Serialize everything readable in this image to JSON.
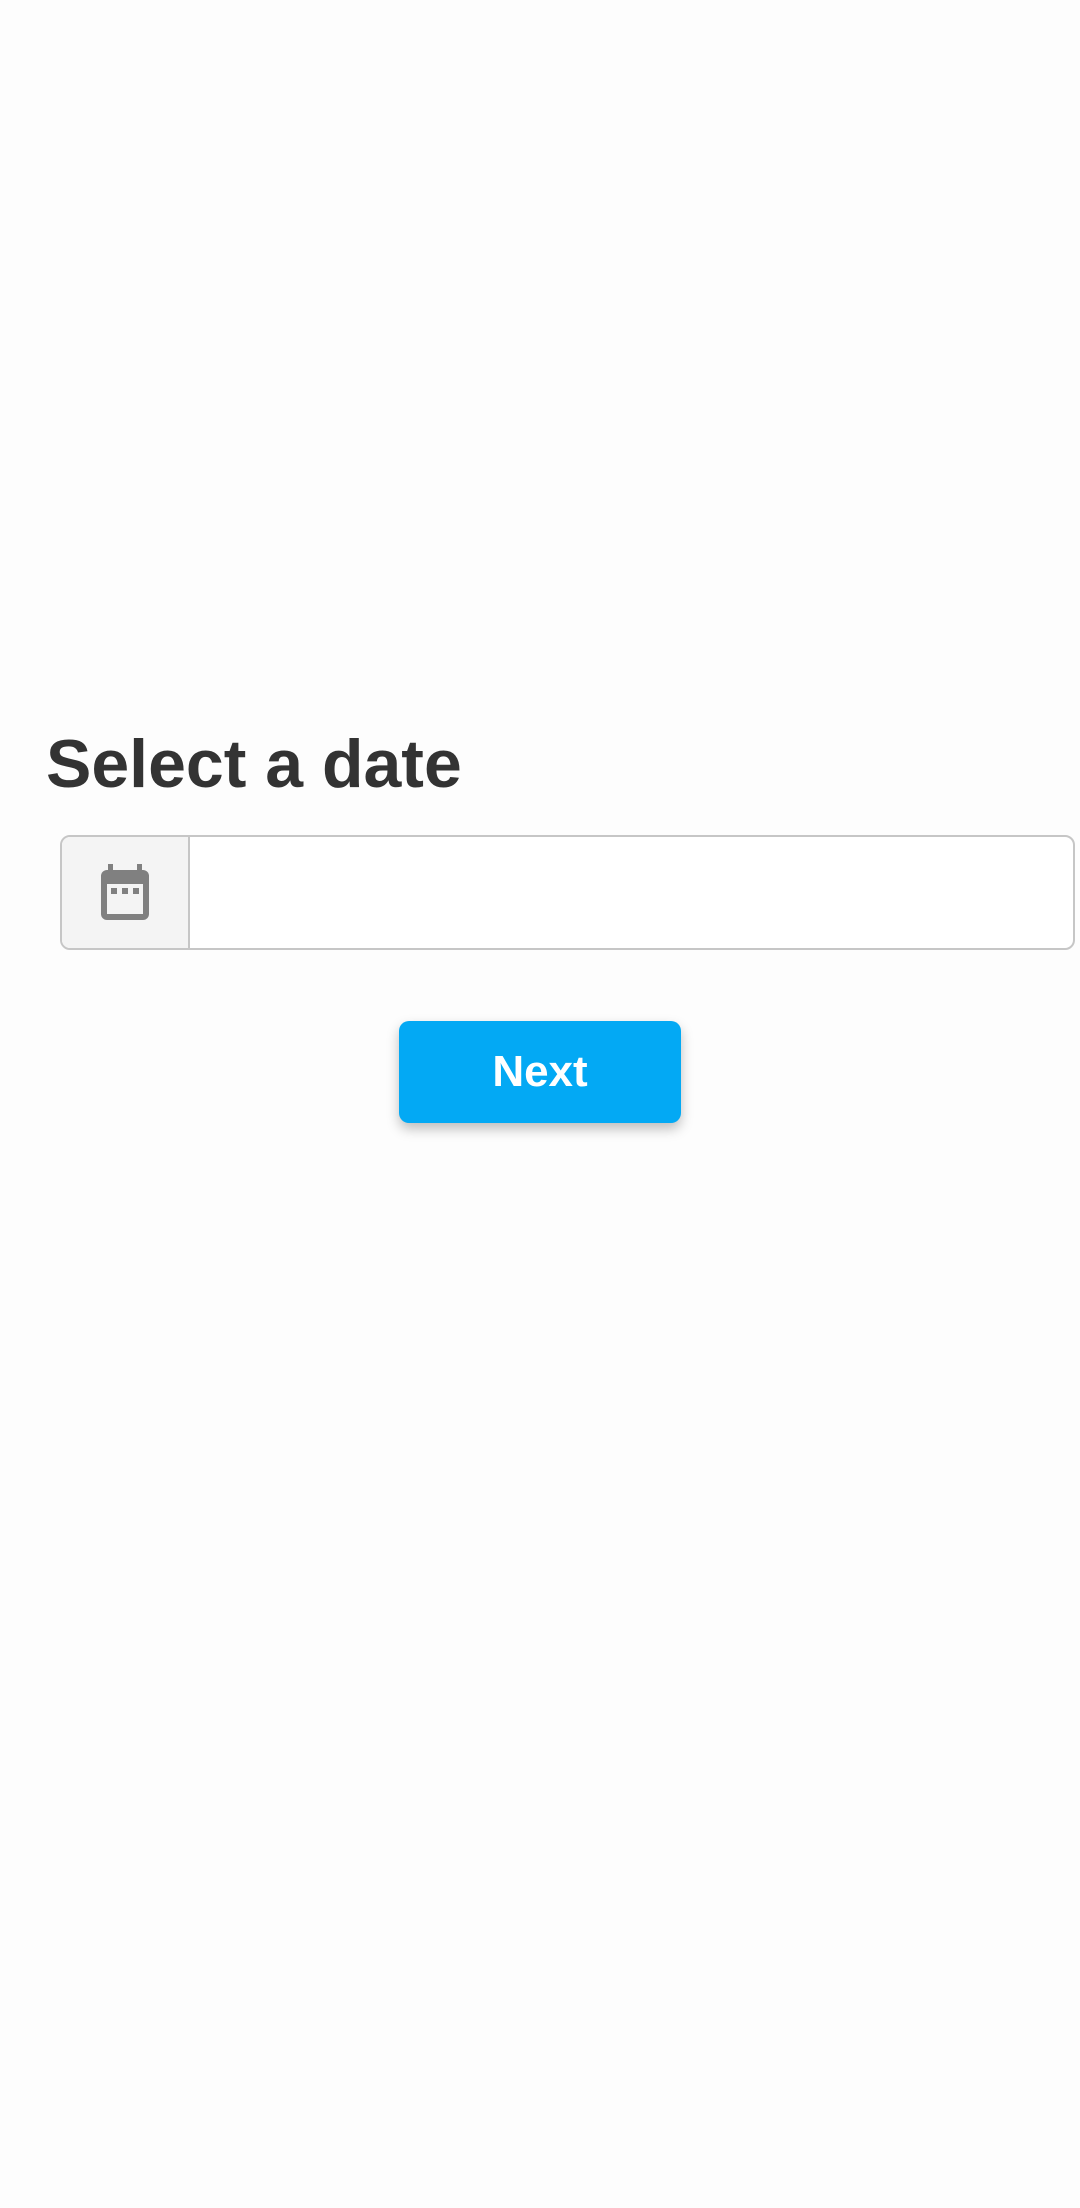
{
  "page": {
    "title": "Select a date"
  },
  "date_input": {
    "value": "",
    "placeholder": "",
    "icon": "calendar-icon"
  },
  "actions": {
    "next_label": "Next"
  },
  "colors": {
    "accent": "#03a9f4",
    "title_text": "#333333",
    "icon": "#808080",
    "background": "#fdfdfd"
  }
}
